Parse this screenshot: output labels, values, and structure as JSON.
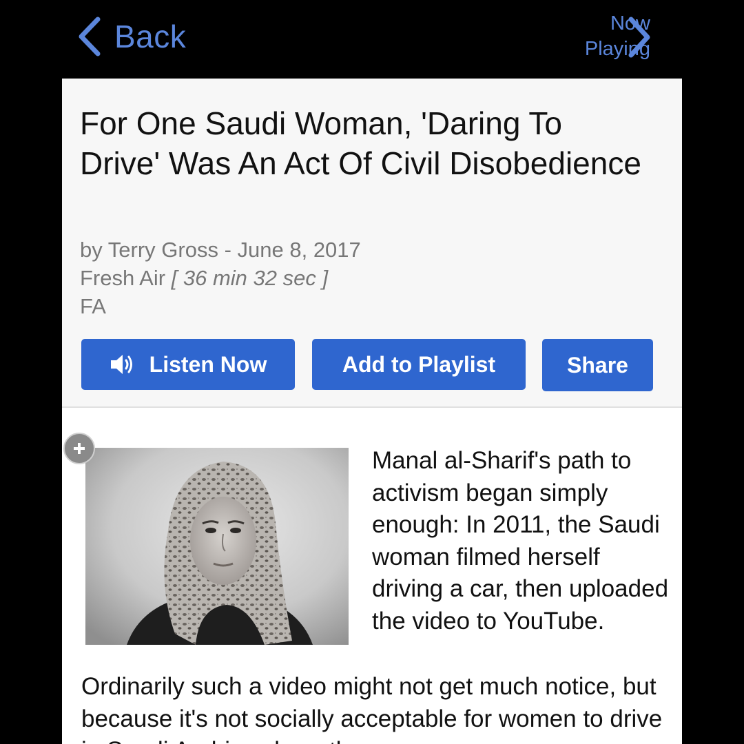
{
  "nav": {
    "back_label": "Back",
    "now_playing_line1": "Now",
    "now_playing_line2": "Playing"
  },
  "story": {
    "title": "For One Saudi Woman, 'Daring To Drive' Was An Act Of Civil Disobedience",
    "byline": "by Terry Gross - June 8, 2017",
    "program": "Fresh Air",
    "duration": "[ 36 min 32 sec ]",
    "program_code": "FA"
  },
  "actions": {
    "listen_label": "Listen Now",
    "playlist_label": "Add to Playlist",
    "share_label": "Share"
  },
  "article": {
    "image_alt": "Manal al-Sharif portrait",
    "paragraph_wrap": "Manal al-Sharif's path to activism began simply enough: In 2011, the Saudi woman filmed herself driving a car, then uploaded the video to YouTube.",
    "paragraph_continued": "Ordinarily such a video might not get much notice, but because it's not socially acceptable for women to drive in Saudi Arabia, where the"
  },
  "colors": {
    "accent": "#5b86dc",
    "button": "#2f66cf",
    "header_bg": "#f7f7f7",
    "meta_text": "#777777"
  },
  "icons": {
    "back": "chevron-left-icon",
    "now_playing": "chevron-right-icon",
    "listen": "speaker-icon",
    "expand": "plus-icon"
  }
}
